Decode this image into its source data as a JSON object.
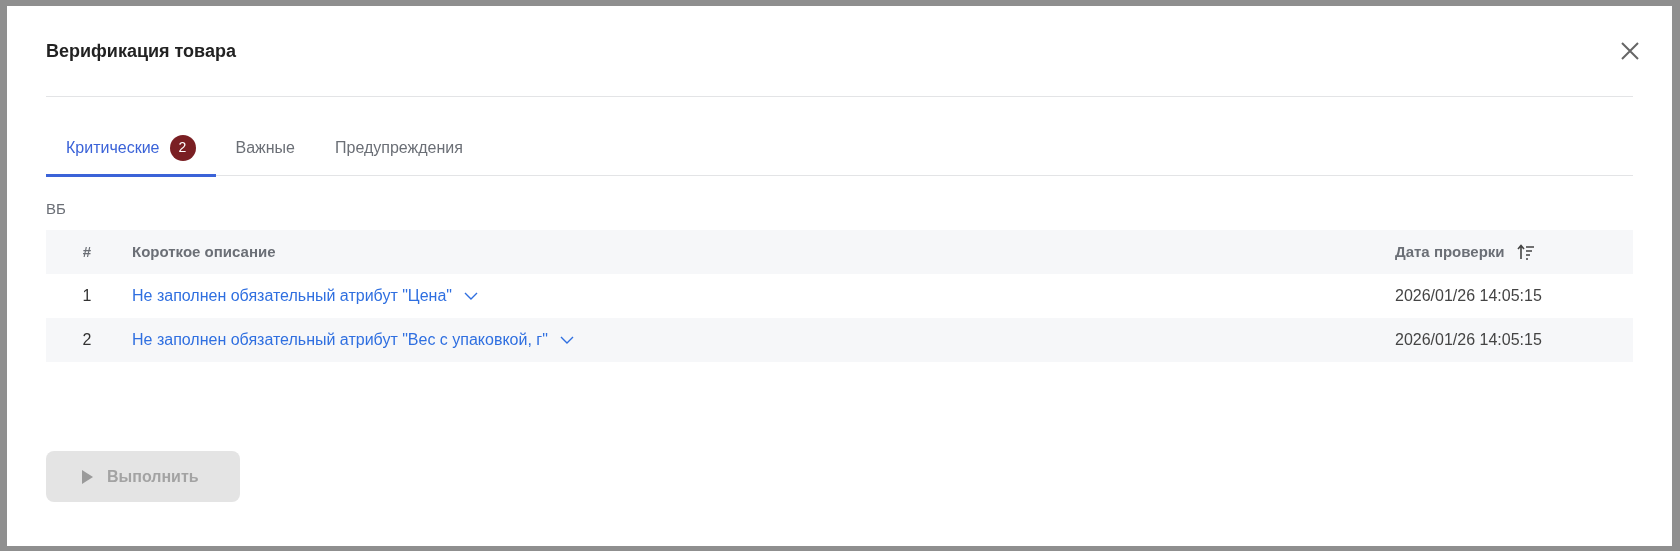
{
  "dialog": {
    "title": "Верификация товара"
  },
  "tabs": [
    {
      "label": "Критические",
      "badge": "2",
      "selected": true
    },
    {
      "label": "Важные",
      "selected": false
    },
    {
      "label": "Предупреждения",
      "selected": false
    }
  ],
  "section_label": "ВБ",
  "table": {
    "columns": [
      "#",
      "Короткое описание",
      "Дата проверки"
    ],
    "rows": [
      {
        "index": "1",
        "description": "Не заполнен обязательный атрибут \"Цена\"",
        "date": "2026/01/26 14:05:15",
        "expanded": false
      },
      {
        "index": "2",
        "description": "Не заполнен обязательный атрибут \"Вес с упаковкой, г\"",
        "date": "2026/01/26 14:05:15",
        "expanded": false
      }
    ]
  },
  "run_button": {
    "label": "Выполнить",
    "disabled": true
  }
}
